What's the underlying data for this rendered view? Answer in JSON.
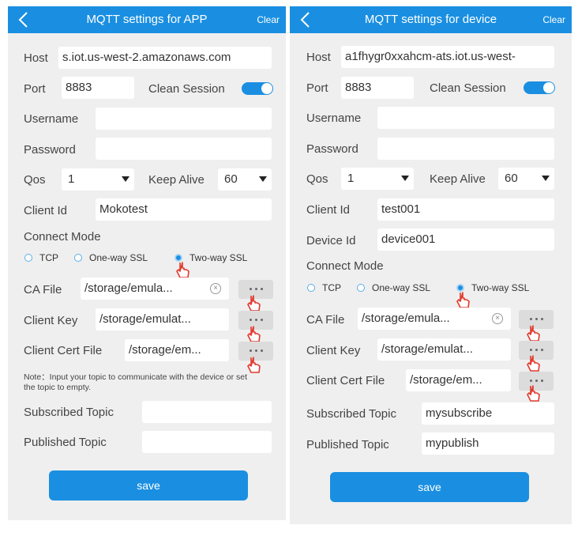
{
  "app": {
    "header": {
      "title": "MQTT settings for APP",
      "clear_label": "Clear"
    },
    "host": {
      "label": "Host",
      "value": "s.iot.us-west-2.amazonaws.com"
    },
    "port": {
      "label": "Port",
      "value": "8883"
    },
    "clean_session": {
      "label": "Clean Session",
      "on": true
    },
    "username": {
      "label": "Username",
      "value": ""
    },
    "password": {
      "label": "Password",
      "value": ""
    },
    "qos": {
      "label": "Qos",
      "value": "1"
    },
    "keep_alive": {
      "label": "Keep Alive",
      "value": "60"
    },
    "client_id": {
      "label": "Client Id",
      "value": "Mokotest"
    },
    "connect_mode": {
      "label": "Connect Mode",
      "options": [
        "TCP",
        "One-way SSL",
        "Two-way SSL"
      ],
      "selected": "Two-way SSL"
    },
    "ca_file": {
      "label": "CA File",
      "value": "/storage/emula..."
    },
    "client_key": {
      "label": "Client Key",
      "value": "/storage/emulat..."
    },
    "client_cert": {
      "label": "Client Cert File",
      "value": "/storage/em..."
    },
    "note": "Note：Input your topic to communicate with the device or set the topic to empty.",
    "subscribed_topic": {
      "label": "Subscribed Topic",
      "value": ""
    },
    "published_topic": {
      "label": "Published Topic",
      "value": ""
    },
    "save_label": "save"
  },
  "device": {
    "header": {
      "title": "MQTT settings for device",
      "clear_label": "Clear"
    },
    "host": {
      "label": "Host",
      "value": "a1fhygr0xxahcm-ats.iot.us-west-"
    },
    "port": {
      "label": "Port",
      "value": "8883"
    },
    "clean_session": {
      "label": "Clean Session",
      "on": true
    },
    "username": {
      "label": "Username",
      "value": ""
    },
    "password": {
      "label": "Password",
      "value": ""
    },
    "qos": {
      "label": "Qos",
      "value": "1"
    },
    "keep_alive": {
      "label": "Keep Alive",
      "value": "60"
    },
    "client_id": {
      "label": "Client Id",
      "value": "test001"
    },
    "device_id": {
      "label": "Device Id",
      "value": "device001"
    },
    "connect_mode": {
      "label": "Connect Mode",
      "options": [
        "TCP",
        "One-way SSL",
        "Two-way SSL"
      ],
      "selected": "Two-way SSL"
    },
    "ca_file": {
      "label": "CA File",
      "value": "/storage/emula..."
    },
    "client_key": {
      "label": "Client Key",
      "value": "/storage/emulat..."
    },
    "client_cert": {
      "label": "Client Cert File",
      "value": "/storage/em..."
    },
    "subscribed_topic": {
      "label": "Subscribed Topic",
      "value": "mysubscribe"
    },
    "published_topic": {
      "label": "Published Topic",
      "value": "mypublish"
    },
    "save_label": "save"
  },
  "colors": {
    "accent": "#1a8fe1",
    "panel_bg": "#efefef",
    "field_bg": "#ffffff",
    "annotation_red": "#e23a2e"
  },
  "icons": [
    "back-arrow-icon",
    "clear-circle-icon",
    "more-dots-icon",
    "pointer-hand-icon",
    "dropdown-caret-icon"
  ]
}
